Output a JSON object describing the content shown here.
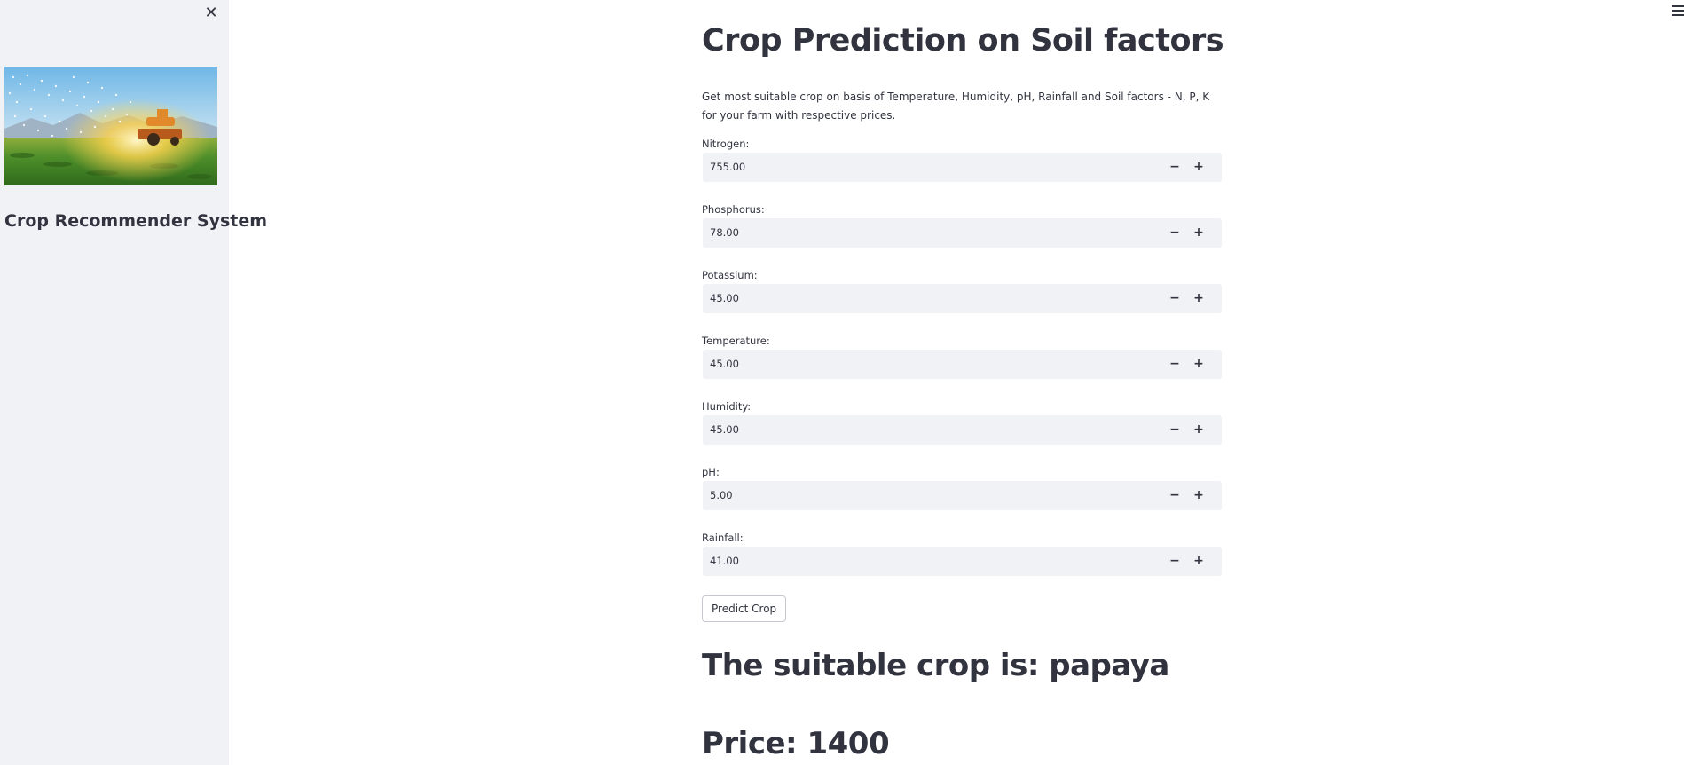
{
  "sidebar": {
    "close_icon": "close-icon",
    "title": "Crop Recommender System",
    "image_subject": "tractor spraying crop field at sunrise"
  },
  "header": {
    "menu_icon": "hamburger-menu-icon"
  },
  "main": {
    "title": "Crop Prediction on Soil factors",
    "description": "Get most suitable crop on basis of Temperature, Humidity, pH, Rainfall and Soil factors - N, P, K for your farm with respective prices.",
    "fields": [
      {
        "label": "Nitrogen:",
        "value": "755.00"
      },
      {
        "label": "Phosphorus:",
        "value": "78.00"
      },
      {
        "label": "Potassium:",
        "value": "45.00"
      },
      {
        "label": "Temperature:",
        "value": "45.00"
      },
      {
        "label": "Humidity:",
        "value": "45.00"
      },
      {
        "label": "pH:",
        "value": "5.00"
      },
      {
        "label": "Rainfall:",
        "value": "41.00"
      }
    ],
    "stepper": {
      "minus": "−",
      "plus": "+"
    },
    "predict_button": "Predict Crop",
    "result_crop": "The suitable crop is: papaya",
    "result_price": "Price: 1400"
  },
  "colors": {
    "sidebar_bg": "#f0f2f6",
    "input_bg": "#f0f2f6",
    "text": "#31333f"
  }
}
